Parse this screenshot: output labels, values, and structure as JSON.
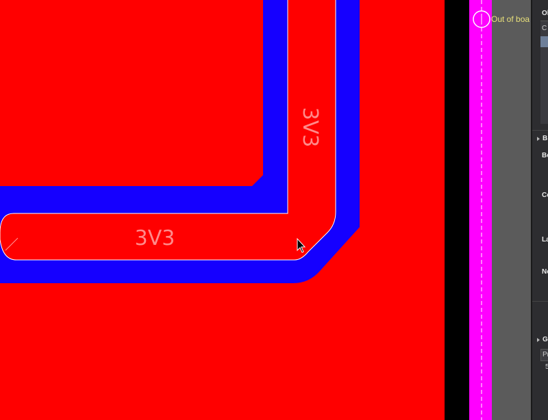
{
  "canvas": {
    "net_labels": [
      "3V3",
      "3V3"
    ],
    "boundary_label": "Out of boa",
    "colors": {
      "copper_top": "#ff0000",
      "copper_bottom": "#1500ff",
      "board_outline": "#ff00ff",
      "background": "#000000",
      "outer_area": "#5b5b5b",
      "label_text": "#ff8a8a"
    }
  },
  "properties_panel": {
    "section_top": "Ol",
    "list_item": "C",
    "section_board": "B",
    "field_bo": "Bo",
    "field_co": "Co",
    "field_la": "La",
    "field_ne": "Ne",
    "section_grid": "G",
    "grid_header": "Pr",
    "grid_value": "5"
  },
  "cursor_icon": "arrow-pointer-icon"
}
